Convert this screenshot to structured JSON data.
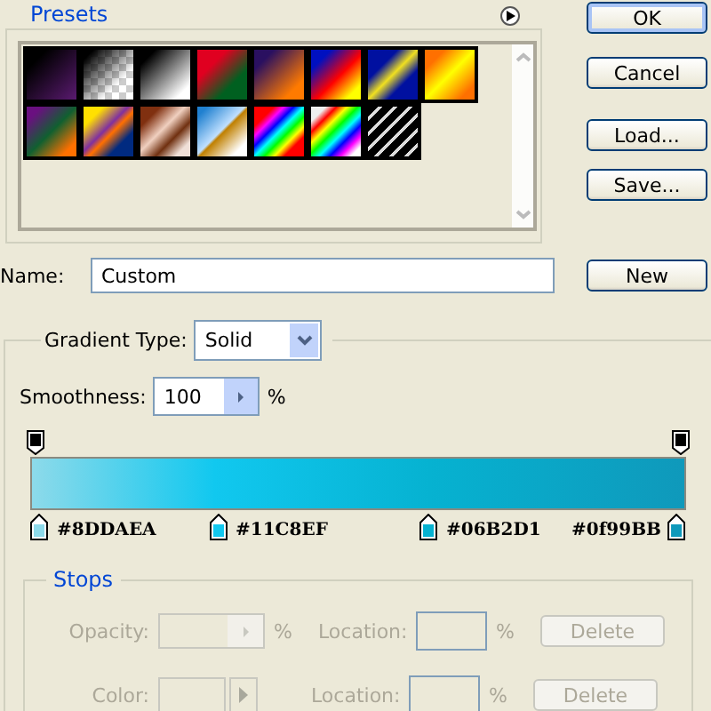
{
  "presets": {
    "title": "Presets"
  },
  "buttons": [
    {
      "label": "OK",
      "default": true
    },
    {
      "label": "Cancel",
      "default": false
    },
    {
      "label": "Load...",
      "default": false
    },
    {
      "label": "Save..."
    }
  ],
  "name": {
    "label": "Name:",
    "value": "Custom",
    "button": "New"
  },
  "gradient": {
    "type_label": "Gradient Type:",
    "type_value": "Solid",
    "smoothness_label": "Smoothness:",
    "smoothness_value": "100",
    "unit": "%"
  },
  "color_stops": [
    {
      "label": "#8DDAEA",
      "color": "#8ddaea"
    },
    {
      "label": "#11C8EF",
      "color": "#11c8ef"
    },
    {
      "label": "#06B2D1",
      "color": "#06b2d1"
    },
    {
      "label": "#0f99BB",
      "color": "#0f99bb"
    }
  ],
  "stops": {
    "title": "Stops",
    "rows": [
      {
        "kind": "opacity",
        "label": "Opacity:",
        "unit": "%",
        "location_label": "Location:",
        "location_unit": "%",
        "button": "Delete",
        "disabled": true
      },
      {
        "kind": "color",
        "label": "Color:",
        "location_label": "Location:",
        "location_unit": "%",
        "button": "Delete",
        "disabled": true
      }
    ]
  }
}
